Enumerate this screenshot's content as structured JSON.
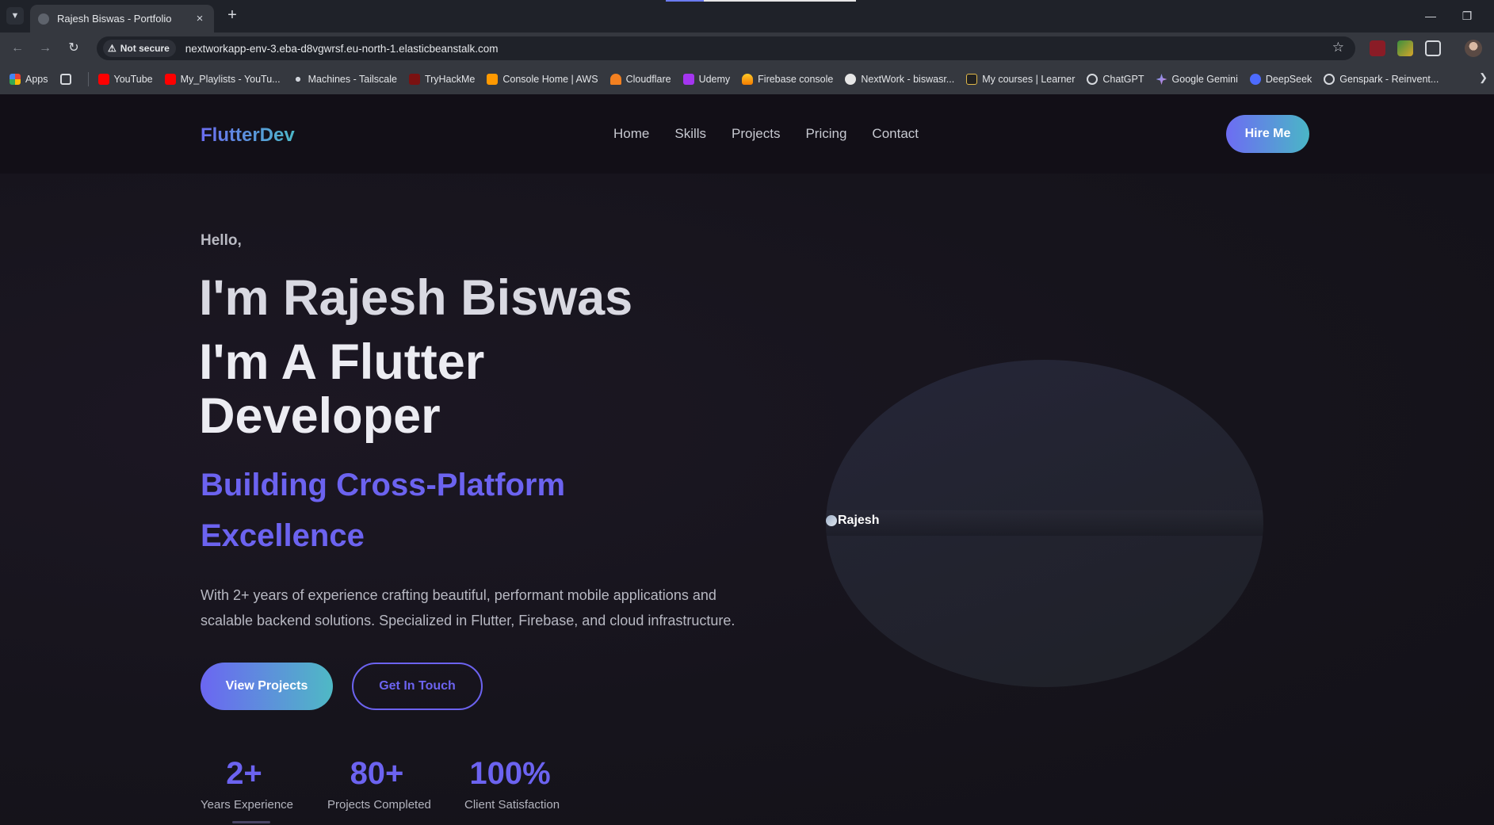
{
  "browser": {
    "tab_title": "Rajesh Biswas - Portfolio",
    "tab_close": "×",
    "new_tab": "+",
    "security_label": "Not secure",
    "url": "nextworkapp-env-3.eba-d8vgwrsf.eu-north-1.elasticbeanstalk.com",
    "bookmarks": [
      {
        "label": "Apps",
        "color": "#e94235"
      },
      {
        "label": "YouTube",
        "color": "#ff0000"
      },
      {
        "label": "My_Playlists - YouTu...",
        "color": "#ff0000"
      },
      {
        "label": "Machines - Tailscale",
        "color": "#cfd3da"
      },
      {
        "label": "TryHackMe",
        "color": "#c11111"
      },
      {
        "label": "Console Home | AWS",
        "color": "#f90"
      },
      {
        "label": "Cloudflare",
        "color": "#f38020"
      },
      {
        "label": "Udemy",
        "color": "#a435f0"
      },
      {
        "label": "Firebase console",
        "color": "#ffa000"
      },
      {
        "label": "NextWork - biswasr...",
        "color": "#e6e6e6"
      },
      {
        "label": "My courses | Learner",
        "color": "#222222"
      },
      {
        "label": "ChatGPT",
        "color": "#d6d9de"
      },
      {
        "label": "Google Gemini",
        "color": "#6d9cf0"
      },
      {
        "label": "DeepSeek",
        "color": "#4d6bfe"
      },
      {
        "label": "Genspark - Reinvent...",
        "color": "#d6d9de"
      }
    ]
  },
  "site": {
    "logo": "FlutterDev",
    "nav": [
      "Home",
      "Skills",
      "Projects",
      "Pricing",
      "Contact"
    ],
    "hire_button": "Hire Me",
    "hero": {
      "greeting": "Hello,",
      "name": "I'm Rajesh Biswas",
      "role": "I'm A Flutter Developer",
      "tagline": "Building Cross-Platform Excellence",
      "description": "With 2+ years of experience crafting beautiful, performant mobile applications and scalable backend solutions. Specialized in Flutter, Firebase, and cloud infrastructure.",
      "primary_button": "View Projects",
      "secondary_button": "Get In Touch",
      "image_alt": "Rajesh"
    },
    "stats": [
      {
        "value": "2+",
        "label": "Years Experience"
      },
      {
        "value": "80+",
        "label": "Projects Completed"
      },
      {
        "value": "100%",
        "label": "Client Satisfaction"
      }
    ]
  },
  "colors": {
    "accent": "#6c63f0",
    "gradient_start": "#6b66f2",
    "gradient_end": "#4fb9c5",
    "background": "#16141c"
  }
}
